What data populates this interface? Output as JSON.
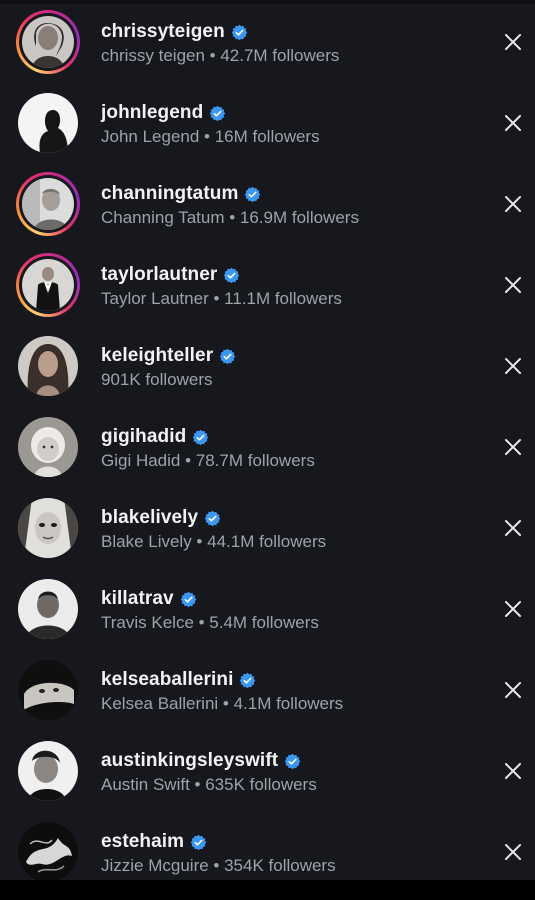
{
  "suggested_accounts": [
    {
      "username": "chrissyteigen",
      "subtitle": "chrissy teigen • 42.7M followers",
      "verified": true,
      "story_ring": true,
      "avatar_icon": "person-portrait-icon"
    },
    {
      "username": "johnlegend",
      "subtitle": "John Legend • 16M followers",
      "verified": true,
      "story_ring": false,
      "avatar_icon": "person-profile-icon"
    },
    {
      "username": "channingtatum",
      "subtitle": "Channing Tatum • 16.9M followers",
      "verified": true,
      "story_ring": true,
      "avatar_icon": "person-portrait-icon"
    },
    {
      "username": "taylorlautner",
      "subtitle": "Taylor Lautner • 11.1M followers",
      "verified": true,
      "story_ring": true,
      "avatar_icon": "person-tuxedo-icon"
    },
    {
      "username": "keleighteller",
      "subtitle": "901K followers",
      "verified": true,
      "story_ring": false,
      "avatar_icon": "person-portrait-icon"
    },
    {
      "username": "gigihadid",
      "subtitle": "Gigi Hadid • 78.7M followers",
      "verified": true,
      "story_ring": false,
      "avatar_icon": "person-child-icon"
    },
    {
      "username": "blakelively",
      "subtitle": "Blake Lively • 44.1M followers",
      "verified": true,
      "story_ring": false,
      "avatar_icon": "person-portrait-icon"
    },
    {
      "username": "killatrav",
      "subtitle": "Travis Kelce • 5.4M followers",
      "verified": true,
      "story_ring": false,
      "avatar_icon": "person-portrait-icon"
    },
    {
      "username": "kelseaballerini",
      "subtitle": "Kelsea Ballerini • 4.1M followers",
      "verified": true,
      "story_ring": false,
      "avatar_icon": "person-portrait-icon"
    },
    {
      "username": "austinkingsleyswift",
      "subtitle": "Austin Swift • 635K followers",
      "verified": true,
      "story_ring": false,
      "avatar_icon": "person-portrait-icon"
    },
    {
      "username": "estehaim",
      "subtitle": "Jizzie Mcguire • 354K followers",
      "verified": true,
      "story_ring": false,
      "avatar_icon": "abstract-art-icon"
    }
  ],
  "colors": {
    "background": "#16181d",
    "username": "#f2f3f5",
    "subtitle": "#9ea2a9",
    "verified_badge": "#3b97f0",
    "close_icon": "#e8e9ec"
  }
}
